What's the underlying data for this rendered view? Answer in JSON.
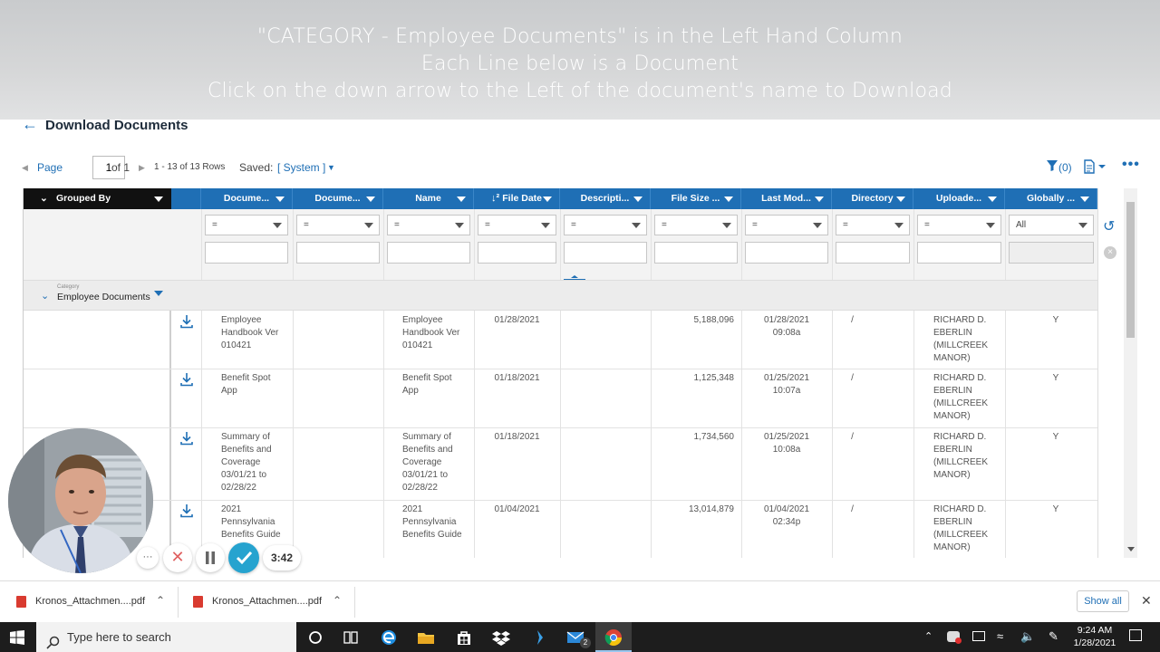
{
  "caption": {
    "line1": "\"CATEGORY - Employee Documents\" is in the Left Hand Column",
    "line2": "Each Line below is a Document",
    "line3": "Click on the down arrow to the Left of the document's name to Download"
  },
  "heading": "Download Documents",
  "pager": {
    "page_label": "Page",
    "page_value": "1",
    "of_label": "of 1",
    "rows_label": "1 - 13 of 13 Rows",
    "saved_label": "Saved:",
    "saved_value": "[ System ]",
    "filter_count": "(0)"
  },
  "grid": {
    "grouped_by_label": "Grouped By",
    "columns": [
      "Docume...",
      "Docume...",
      "Name",
      "File Date",
      "Descripti...",
      "File Size ...",
      "Last Mod...",
      "Directory",
      "Uploade...",
      "Globally ..."
    ],
    "filter_eq": "=",
    "filter_all": "All",
    "group_category_label": "Category",
    "group_value": "Employee Documents",
    "rows": [
      {
        "doc": [
          "Employee",
          "Handbook Ver",
          "010421"
        ],
        "name": [
          "Employee",
          "Handbook Ver",
          "010421"
        ],
        "date": "01/28/2021",
        "size": "5,188,096",
        "mod": [
          "01/28/2021",
          "09:08a"
        ],
        "dir": "/",
        "uploader": [
          "RICHARD D.",
          "EBERLIN",
          "(MILLCREEK",
          "MANOR)"
        ],
        "global": "Y"
      },
      {
        "doc": [
          "Benefit Spot",
          "App"
        ],
        "name": [
          "Benefit Spot",
          "App"
        ],
        "date": "01/18/2021",
        "size": "1,125,348",
        "mod": [
          "01/25/2021",
          "10:07a"
        ],
        "dir": "/",
        "uploader": [
          "RICHARD D.",
          "EBERLIN",
          "(MILLCREEK",
          "MANOR)"
        ],
        "global": "Y"
      },
      {
        "doc": [
          "Summary of",
          "Benefits and",
          "Coverage",
          "03/01/21 to",
          "02/28/22"
        ],
        "name": [
          "Summary of",
          "Benefits and",
          "Coverage",
          "03/01/21 to",
          "02/28/22"
        ],
        "date": "01/18/2021",
        "size": "1,734,560",
        "mod": [
          "01/25/2021",
          "10:08a"
        ],
        "dir": "/",
        "uploader": [
          "RICHARD D.",
          "EBERLIN",
          "(MILLCREEK",
          "MANOR)"
        ],
        "global": "Y"
      },
      {
        "doc": [
          "2021",
          "Pennsylvania",
          "Benefits Guide"
        ],
        "name": [
          "2021",
          "Pennsylvania",
          "Benefits Guide"
        ],
        "date": "01/04/2021",
        "size": "13,014,879",
        "mod": [
          "01/04/2021",
          "02:34p"
        ],
        "dir": "/",
        "uploader": [
          "RICHARD D.",
          "EBERLIN",
          "(MILLCREEK",
          "MANOR)"
        ],
        "global": "Y"
      }
    ]
  },
  "recorder": {
    "more": "···",
    "time": "3:42"
  },
  "downloads": {
    "items": [
      "Kronos_Attachmen....pdf",
      "Kronos_Attachmen....pdf"
    ],
    "show_all": "Show all"
  },
  "taskbar": {
    "search_placeholder": "Type here to search",
    "mail_badge": "2",
    "time": "9:24 AM",
    "date": "1/28/2021"
  },
  "colors": {
    "accent": "#1f6fb5",
    "header_black": "#111111",
    "taskbar": "#1d1d1d"
  }
}
